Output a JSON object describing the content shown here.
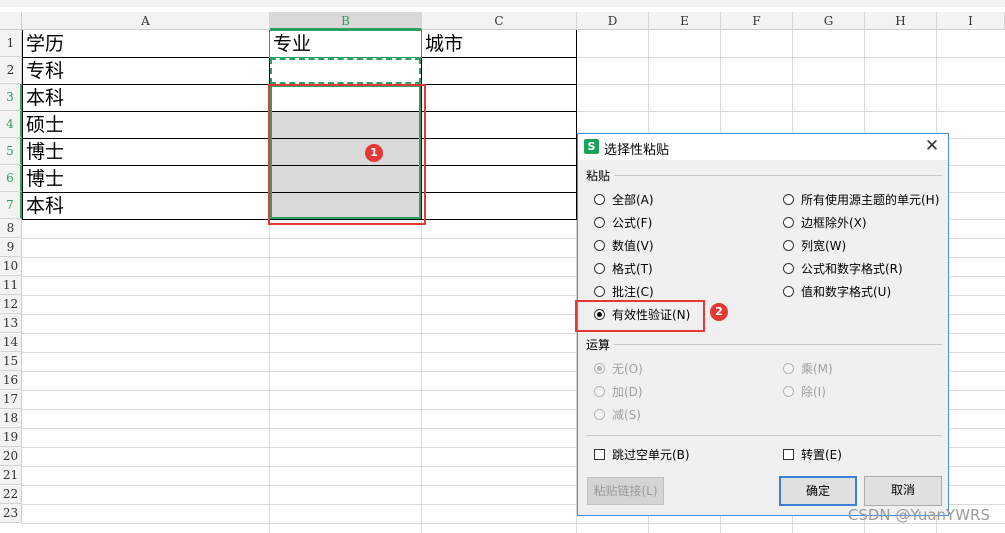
{
  "sheet": {
    "columns": [
      "A",
      "B",
      "C",
      "D",
      "E",
      "F",
      "G",
      "H",
      "I"
    ],
    "rows": [
      "1",
      "2",
      "3",
      "4",
      "5",
      "6",
      "7",
      "8",
      "9",
      "10",
      "11",
      "12",
      "13",
      "14",
      "15",
      "16",
      "17",
      "18",
      "19",
      "20",
      "21",
      "22",
      "23"
    ],
    "selected_column": "B",
    "selected_rows": [
      "3",
      "4",
      "5",
      "6",
      "7"
    ],
    "cells": {
      "A1": "学历",
      "B1": "专业",
      "C1": "城市",
      "A2": "专科",
      "A3": "本科",
      "A4": "硕士",
      "A5": "博士",
      "A6": "博士",
      "A7": "本科"
    }
  },
  "dialog": {
    "title": "选择性粘贴",
    "app_icon_letter": "S",
    "close_glyph": "✕",
    "paste_group_label": "粘贴",
    "paste_options_left": [
      "全部(A)",
      "公式(F)",
      "数值(V)",
      "格式(T)",
      "批注(C)",
      "有效性验证(N)"
    ],
    "paste_options_right": [
      "所有使用源主题的单元(H)",
      "边框除外(X)",
      "列宽(W)",
      "公式和数字格式(R)",
      "值和数字格式(U)"
    ],
    "paste_selected": "有效性验证(N)",
    "operation_group_label": "运算",
    "operation_options_left": [
      "无(O)",
      "加(D)",
      "减(S)"
    ],
    "operation_options_right": [
      "乘(M)",
      "除(I)"
    ],
    "operation_selected": "无(O)",
    "skip_blanks_label": "跳过空单元(B)",
    "skip_blanks_checked": false,
    "transpose_label": "转置(E)",
    "transpose_checked": false,
    "paste_link_label": "粘贴链接(L)",
    "ok_label": "确定",
    "cancel_label": "取消"
  },
  "annotations": {
    "badge_1": "1",
    "badge_2": "2"
  },
  "watermark": "CSDN @YuanYWRS",
  "colors": {
    "selection_green": "#2e9f62",
    "annotation_red": "#e53935",
    "selection_fill": "#d9d9d9",
    "dialog_border": "#4a90d9"
  }
}
